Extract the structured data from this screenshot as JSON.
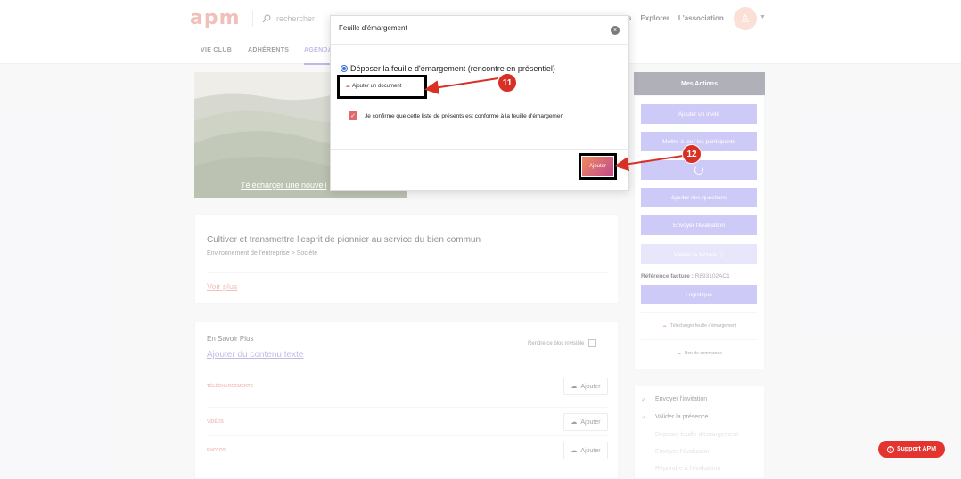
{
  "header": {
    "logo": "apm",
    "search_placeholder": "rechercher",
    "nav": [
      "s",
      "Explorer",
      "L'association"
    ]
  },
  "subnav": {
    "tabs": [
      "VIE CLUB",
      "ADHÉRENTS",
      "AGENDA"
    ]
  },
  "hero": {
    "link": "Télécharger une nouvell"
  },
  "event": {
    "title": "Cultiver et transmettre l'esprit de pionnier au service du bien commun",
    "crumb": "Environnement de l'entreprise > Société",
    "more": "Voir plus"
  },
  "savoir": {
    "title": "En Savoir Plus",
    "add_text": "Ajouter du contenu texte",
    "invisible_label": "Rendre ce bloc invisible",
    "rows": [
      {
        "label": "TÉLÉCHARGEMENTS",
        "button": "Ajouter"
      },
      {
        "label": "VIDÉOS",
        "button": "Ajouter"
      },
      {
        "label": "PHOTOS",
        "button": "Ajouter"
      }
    ]
  },
  "actions": {
    "title": "Mes Actions",
    "buttons": [
      "Ajouter un invité",
      "Mettre à jour les participants",
      "",
      "Ajouter des questions",
      "Envoyer l'évaluation",
      "Valider la facture ⓘ"
    ],
    "reference_label": "Référence facture :",
    "reference_value": "R893102AC1",
    "logistique": "Logistique",
    "download_sheet": "Télécharger feuille d'émargement",
    "bon_commande": "Bon de commande"
  },
  "steps": [
    {
      "label": "Envoyer l'invitation",
      "done": true
    },
    {
      "label": "Valider la présence",
      "done": true
    },
    {
      "label": "Déposer feuille d'émargement",
      "done": false
    },
    {
      "label": "Envoyer l'évaluation",
      "done": false
    },
    {
      "label": "Répondre à l'évaluation",
      "done": false
    }
  ],
  "modal": {
    "title": "Feuille d'émargement",
    "close": "×",
    "radio_label": "Déposer la feuille d'émargement (rencontre en présentiel)",
    "add_document": "Ajouter un document",
    "confirm_text": "Je confirme que cette liste de présents est conforme à la feuille d'émargemen",
    "submit": "Ajouter"
  },
  "callouts": [
    "11",
    "12"
  ],
  "support": "Support APM",
  "colors": {
    "accent": "#a79ef0",
    "brand": "#e58c84",
    "callout": "#d93025"
  }
}
